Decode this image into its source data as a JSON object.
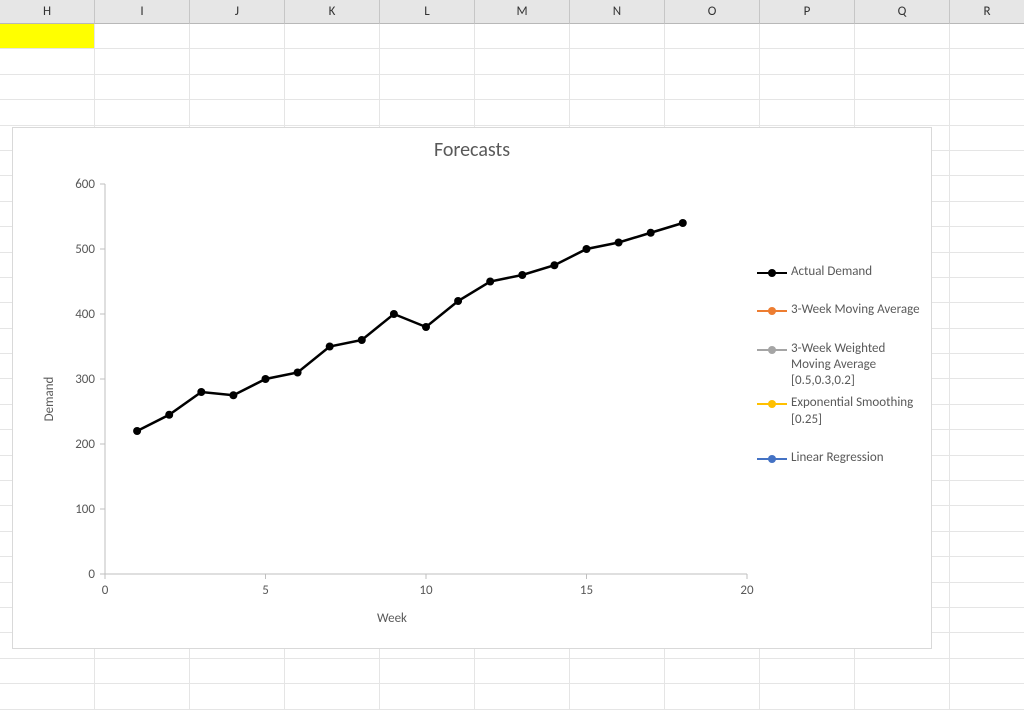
{
  "columns": [
    "H",
    "I",
    "J",
    "K",
    "L",
    "M",
    "N",
    "O",
    "P",
    "Q",
    "R"
  ],
  "chart_data": {
    "type": "line",
    "title": "Forecasts",
    "xlabel": "Week",
    "ylabel": "Demand",
    "xlim": [
      0,
      20
    ],
    "ylim": [
      0,
      600
    ],
    "yticks": [
      0,
      100,
      200,
      300,
      400,
      500,
      600
    ],
    "xticks": [
      0,
      5,
      10,
      15,
      20
    ],
    "x": [
      1,
      2,
      3,
      4,
      5,
      6,
      7,
      8,
      9,
      10,
      11,
      12,
      13,
      14,
      15,
      16,
      17,
      18
    ],
    "series": [
      {
        "name": "Actual Demand",
        "color": "#000000",
        "values": [
          220,
          245,
          280,
          275,
          300,
          310,
          350,
          360,
          400,
          380,
          420,
          450,
          460,
          475,
          500,
          510,
          525,
          540
        ]
      },
      {
        "name": "3-Week Moving Average",
        "color": "#ED7D31",
        "values": null
      },
      {
        "name": "3-Week Weighted Moving Average [0.5,0.3,0.2]",
        "color": "#A5A5A5",
        "values": null
      },
      {
        "name": "Exponential Smoothing [0.25]",
        "color": "#FFC000",
        "values": null
      },
      {
        "name": "Linear Regression",
        "color": "#4472C4",
        "values": null
      }
    ]
  }
}
